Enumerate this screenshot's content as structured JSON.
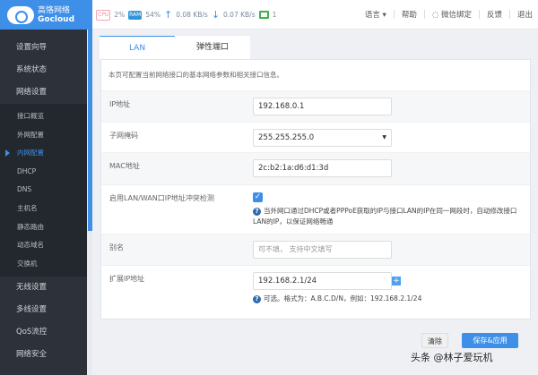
{
  "header": {
    "brand_cn": "高恪网络",
    "brand_en": "Gocloud",
    "cpu_label": "CPU",
    "cpu": "2%",
    "ram_label": "RAM",
    "ram": "54%",
    "upload": "0.08 KB/s",
    "download": "0.07 KB/s",
    "devices": "1",
    "nav": {
      "language": "语言",
      "help": "帮助",
      "wechat": "微信绑定",
      "feedback": "反馈",
      "logout": "退出"
    }
  },
  "sidebar": {
    "top": [
      "设置向导",
      "系统状态",
      "网络设置"
    ],
    "sub": [
      "接口概览",
      "外网配置",
      "内网配置",
      "DHCP",
      "DNS",
      "主机名",
      "静态路由",
      "动态域名",
      "交换机"
    ],
    "bottom": [
      "无线设置",
      "多线设置",
      "QoS流控",
      "网络安全"
    ]
  },
  "tabs": [
    "LAN",
    "弹性端口"
  ],
  "description": "本页可配置当前网络接口的基本网络参数和相关接口信息。",
  "form": {
    "ip_label": "IP地址",
    "ip": "192.168.0.1",
    "mask_label": "子网掩码",
    "mask": "255.255.255.0",
    "mac_label": "MAC地址",
    "mac": "2c:b2:1a:d6:d1:3d",
    "conflict_label": "启用LAN/WAN口IP地址冲突检测",
    "conflict_checked": true,
    "conflict_help": "当外网口通过DHCP或者PPPoE获取的IP与接口LAN的IP在同一网段时，自动修改接口LAN的IP，以保证网络畅通",
    "alias_label": "别名",
    "alias_placeholder": "可不填， 支持中文填写",
    "ext_label": "扩展IP地址",
    "ext": "192.168.2.1/24",
    "ext_help": "可选。格式为：A.B.C.D/N，例如：192.168.2.1/24"
  },
  "buttons": {
    "clear": "清除",
    "save": "保存&应用"
  },
  "watermark": "头条 @林子爱玩机"
}
